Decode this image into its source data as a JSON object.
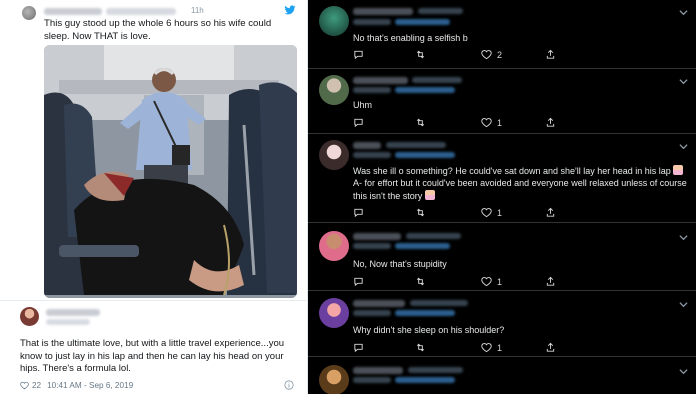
{
  "left_tweet": {
    "time": "11h",
    "text": "This guy stood up the whole 6 hours so his wife could sleep. Now THAT is love.",
    "icons": [
      "twitter-bird-icon"
    ]
  },
  "left_reply": {
    "text": "That is the ultimate love, but with a little travel experience...you know to just lay in his lap and then he can lay his head on your hips. There's a formula lol.",
    "likes": "22",
    "timestamp": "10:41 AM - Sep 6, 2019",
    "icons": [
      "heart-icon",
      "info-icon"
    ]
  },
  "replies": [
    {
      "text": "No that's enabling a selfish b",
      "likes": "2",
      "has_emoji": false
    },
    {
      "text": "Uhm",
      "likes": "1",
      "has_emoji": false
    },
    {
      "text": "Was she ill o something? He could've sat down and she'll lay her head in his lap",
      "text2": " A- for effort but it could've been avoided and everyone well relaxed unless of course this isn't the story",
      "likes": "1",
      "has_emoji": true
    },
    {
      "text": "No, Now that's stupidity",
      "likes": "1",
      "has_emoji": false
    },
    {
      "text": "Why didn't she sleep on his shoulder?",
      "likes": "1",
      "has_emoji": false
    }
  ],
  "colors": {
    "dark_bg": "#000000",
    "twitter_blue": "#1da1f2",
    "light_text": "#14171a"
  }
}
